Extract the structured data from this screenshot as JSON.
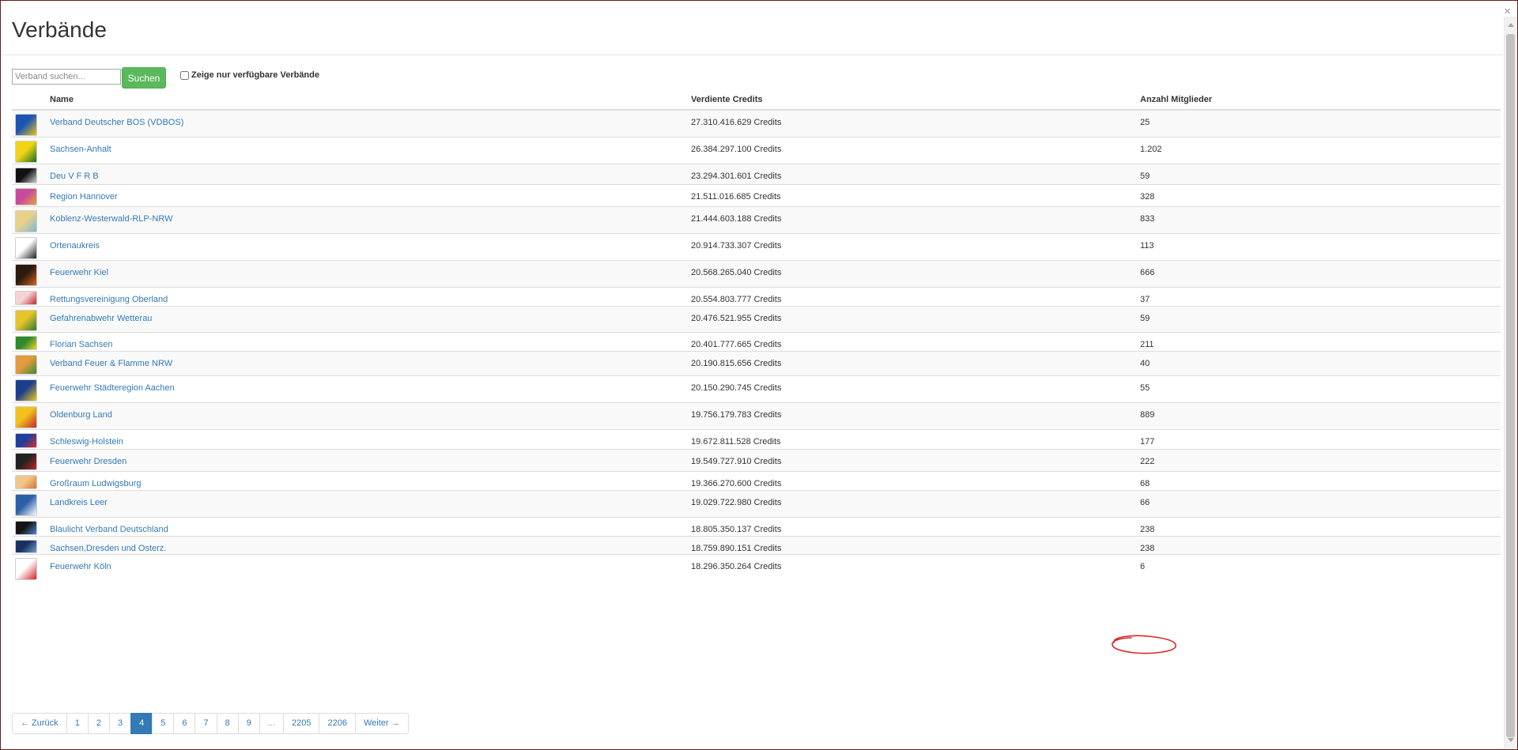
{
  "page": {
    "title": "Verbände",
    "close_glyph": "×"
  },
  "search": {
    "placeholder": "Verband suchen...",
    "button_label": "Suchen",
    "filter_label": "Zeige nur verfügbare Verbände"
  },
  "table": {
    "columns": [
      "",
      "Name",
      "Verdiente Credits",
      "Anzahl Mitglieder"
    ],
    "rows": [
      {
        "name": "Verband Deutscher BOS (VDBOS)",
        "credits": "27.310.416.629 Credits",
        "members": "25",
        "logo": "vdbos-logo",
        "colors": [
          "#1b56b5",
          "#e9c21b"
        ],
        "h": 34
      },
      {
        "name": "Sachsen-Anhalt",
        "credits": "26.384.297.100 Credits",
        "members": "1.202",
        "logo": "sachsen-anhalt-logo",
        "colors": [
          "#f2d417",
          "#1a6d1f"
        ],
        "h": 34
      },
      {
        "name": "Deu V F R B",
        "credits": "23.294.301.601 Credits",
        "members": "59",
        "logo": "deuvfrb-logo",
        "colors": [
          "#111111",
          "#cccccc"
        ],
        "h": 26
      },
      {
        "name": "Region Hannover",
        "credits": "21.511.016.685 Credits",
        "members": "328",
        "logo": "region-hannover-logo",
        "colors": [
          "#c84a9c",
          "#e3a33c"
        ],
        "h": 28
      },
      {
        "name": "Koblenz-Westerwald-RLP-NRW",
        "credits": "21.444.603.188 Credits",
        "members": "833",
        "logo": "koblenz-logo",
        "colors": [
          "#e8d28a",
          "#7fb6d4"
        ],
        "h": 34
      },
      {
        "name": "Ortenaukreis",
        "credits": "20.914.733.307 Credits",
        "members": "113",
        "logo": "ortenaukreis-logo",
        "colors": [
          "#ffffff",
          "#222222"
        ],
        "h": 34
      },
      {
        "name": "Feuerwehr Kiel",
        "credits": "20.568.265.040 Credits",
        "members": "666",
        "logo": "feuerwehr-kiel-logo",
        "colors": [
          "#2a1a10",
          "#d8651a"
        ],
        "h": 34
      },
      {
        "name": "Rettungsvereinigung Oberland",
        "credits": "20.554.803.777 Credits",
        "members": "37",
        "logo": "rettungsvereinigung-logo",
        "colors": [
          "#f3d4d4",
          "#c0262c"
        ],
        "h": 24
      },
      {
        "name": "Gefahrenabwehr Wetterau",
        "credits": "20.476.521.955 Credits",
        "members": "59",
        "logo": "gefahrenabwehr-logo",
        "colors": [
          "#e6c42a",
          "#2d7a33"
        ],
        "h": 33
      },
      {
        "name": "Florian Sachsen",
        "credits": "20.401.777.665 Credits",
        "members": "211",
        "logo": "florian-sachsen-logo",
        "colors": [
          "#2d8a2d",
          "#f1d12a"
        ],
        "h": 24
      },
      {
        "name": "Verband Feuer & Flamme NRW",
        "credits": "20.190.815.656 Credits",
        "members": "40",
        "logo": "feuer-flamme-logo",
        "colors": [
          "#e49b3b",
          "#3a8a3a"
        ],
        "h": 31
      },
      {
        "name": "Feuerwehr Städteregion Aachen",
        "credits": "20.150.290.745 Credits",
        "members": "55",
        "logo": "aachen-logo",
        "colors": [
          "#1d3f8a",
          "#f0c61b"
        ],
        "h": 34
      },
      {
        "name": "Oldenburg Land",
        "credits": "19.756.179.783 Credits",
        "members": "889",
        "logo": "oldenburg-logo",
        "colors": [
          "#f2c21b",
          "#c1262c"
        ],
        "h": 34
      },
      {
        "name": "Schleswig-Holstein",
        "credits": "19.672.811.528 Credits",
        "members": "177",
        "logo": "schleswig-holstein-logo",
        "colors": [
          "#1d3f9e",
          "#d92b2b"
        ],
        "h": 25
      },
      {
        "name": "Feuerwehr Dresden",
        "credits": "19.549.727.910 Credits",
        "members": "222",
        "logo": "feuerwehr-dresden-logo",
        "colors": [
          "#222222",
          "#c1262c"
        ],
        "h": 28
      },
      {
        "name": "Großraum Ludwigsburg",
        "credits": "19.366.270.600 Credits",
        "members": "68",
        "logo": "ludwigsburg-logo",
        "colors": [
          "#f1c68a",
          "#d9742a"
        ],
        "h": 24
      },
      {
        "name": "Landkreis Leer",
        "credits": "19.029.722.980 Credits",
        "members": "66",
        "logo": "landkreis-leer-logo",
        "colors": [
          "#2c5fa8",
          "#ffffff"
        ],
        "h": 34
      },
      {
        "name": "Blaulicht Verband Deutschland",
        "credits": "18.805.350.137 Credits",
        "members": "238",
        "logo": "blaulicht-logo",
        "colors": [
          "#151515",
          "#4a8ad8"
        ],
        "h": 24
      },
      {
        "name": "Sachsen,Dresden und Osterz.",
        "credits": "18.759.890.151 Credits",
        "members": "238",
        "logo": "sachsen-dresden-logo",
        "colors": [
          "#1a3060",
          "#6fa0d0"
        ],
        "h": 23
      },
      {
        "name": "Feuerwehr Köln",
        "credits": "18.296.350.264 Credits",
        "members": "6",
        "logo": "feuerwehr-koeln-logo",
        "colors": [
          "#ffffff",
          "#d1232a"
        ],
        "h": 34
      }
    ]
  },
  "annotation": {
    "color": "#d42a2a"
  },
  "pagination": {
    "prev": "← Zurück",
    "next": "Weiter →",
    "pages": [
      "1",
      "2",
      "3",
      "4",
      "5",
      "6",
      "7",
      "8",
      "9",
      "...",
      "2205",
      "2206"
    ],
    "active": "4",
    "ellipsis": "..."
  },
  "colors": {
    "link": "#337ab7",
    "success": "#5cb85c",
    "active_page": "#337ab7"
  }
}
